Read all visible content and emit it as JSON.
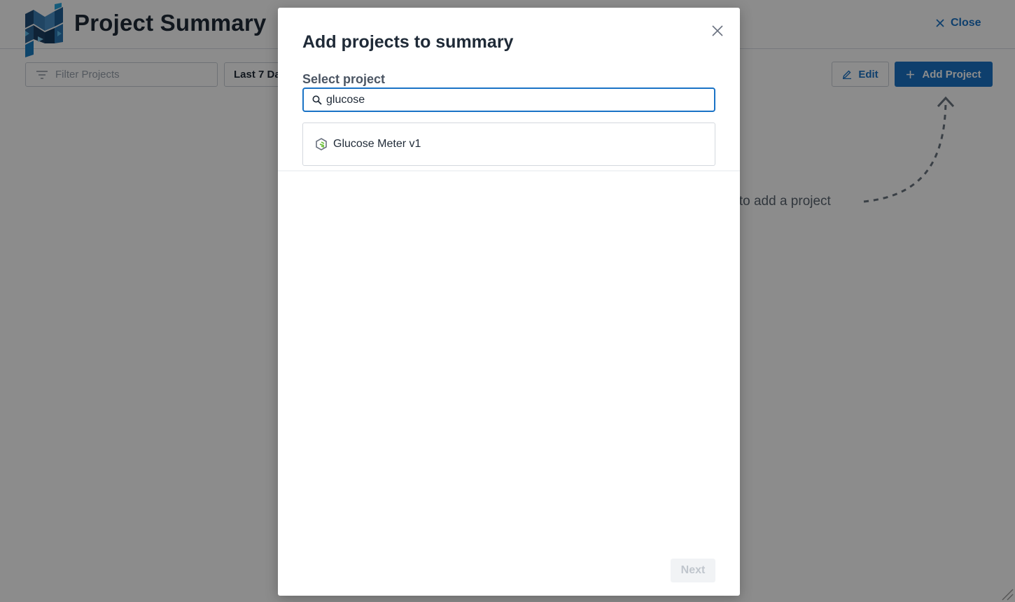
{
  "header": {
    "title": "Project Summary",
    "close_label": "Close"
  },
  "toolbar": {
    "filter_placeholder": "Filter Projects",
    "date_range": "Last 7 Da",
    "edit_label": "Edit",
    "add_project_label": "Add Project"
  },
  "empty_state": {
    "hint": "e to add a project"
  },
  "modal": {
    "title": "Add projects to summary",
    "select_label": "Select project",
    "search_value": "glucose",
    "results": [
      {
        "label": "Glucose Meter v1",
        "icon": "project-logo-icon"
      }
    ],
    "next_label": "Next"
  },
  "colors": {
    "accent": "#1a73c6",
    "overlay": "rgba(0,0,0,0.45)",
    "title_text": "#1f2a37"
  }
}
